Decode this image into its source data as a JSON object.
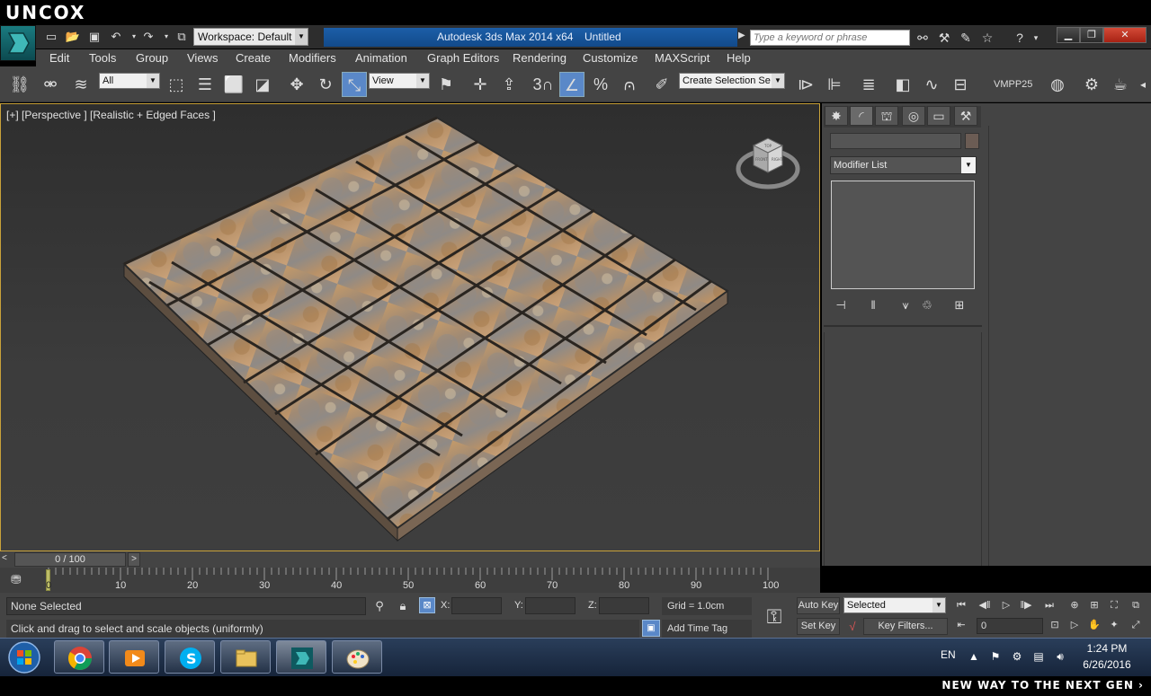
{
  "watermark": {
    "brand": "UNCOX",
    "tagline": "NEW WAY TO THE NEXT GEN ›"
  },
  "titlebar": {
    "workspace_label": "Workspace: Default",
    "app_title": "Autodesk 3ds Max  2014 x64",
    "doc_title": "Untitled",
    "search_placeholder": "Type a keyword or phrase"
  },
  "menu": {
    "items": [
      "Edit",
      "Tools",
      "Group",
      "Views",
      "Create",
      "Modifiers",
      "Animation",
      "Graph Editors",
      "Rendering",
      "Customize",
      "MAXScript",
      "Help"
    ]
  },
  "toolbar": {
    "filter_value": "All",
    "refcoord_value": "View",
    "snap_label": "3",
    "selection_set_placeholder": "Create Selection Se",
    "vmpp_label": "VMPP25"
  },
  "viewport": {
    "label": "[+] [Perspective ] [Realistic + Edged Faces ]",
    "viewcube_labels": [
      "FRONT",
      "RIGHT",
      "TOP"
    ]
  },
  "command_panel": {
    "modifier_list_label": "Modifier List"
  },
  "timeline": {
    "frame_display": "0 / 100",
    "ticks": [
      "0",
      "10",
      "20",
      "30",
      "40",
      "50",
      "60",
      "70",
      "80",
      "90",
      "100"
    ]
  },
  "status": {
    "selection": "None Selected",
    "prompt": "Click and drag to select and scale objects (uniformly)",
    "x_label": "X:",
    "y_label": "Y:",
    "z_label": "Z:",
    "grid": "Grid = 1.0cm",
    "add_time_tag": "Add Time Tag",
    "auto_key": "Auto Key",
    "set_key": "Set Key",
    "selected_combo": "Selected",
    "key_filters": "Key Filters...",
    "frame_value": "0"
  },
  "taskbar": {
    "apps": [
      "chrome",
      "media-player",
      "skype",
      "file-explorer",
      "3ds-max",
      "paint"
    ],
    "lang": "EN",
    "time": "1:24 PM",
    "date": "6/26/2016"
  },
  "colors": {
    "viewport_border": "#c9a23a",
    "active_tool": "#5a88c8",
    "title_highlight": "#1c5ea8"
  }
}
